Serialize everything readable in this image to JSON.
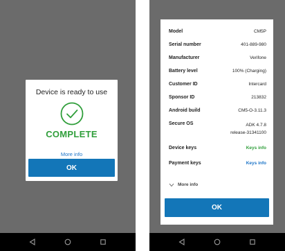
{
  "left_screen": {
    "dialog": {
      "title": "Device is ready to use",
      "status": "COMPLETE",
      "more_info": "More info",
      "ok": "OK",
      "check_icon": "check-circle-icon"
    }
  },
  "right_screen": {
    "rows": [
      {
        "label": "Model",
        "value": "CM5P"
      },
      {
        "label": "Serial number",
        "value": "401-889-980"
      },
      {
        "label": "Manufacturer",
        "value": "Verifone"
      },
      {
        "label": "Battery level",
        "value": "100% (Charging)"
      },
      {
        "label": "Customer ID",
        "value": "Intercard"
      },
      {
        "label": "Sponsor ID",
        "value": "213832"
      },
      {
        "label": "Android build",
        "value": "CM5-O-3.11.3"
      },
      {
        "label": "Secure OS",
        "value_line1": "ADK 4.7.8",
        "value_line2": "release-31341100"
      },
      {
        "label": "Device keys",
        "value": "Keys info"
      },
      {
        "label": "Payment keys",
        "value": "Keys info"
      }
    ],
    "more_info": "More info",
    "ok": "OK"
  },
  "navbar": {
    "back_icon": "back-icon",
    "home_icon": "home-icon",
    "recents_icon": "recents-icon"
  },
  "colors": {
    "accent": "#1376b8",
    "success": "#2f9e3a",
    "link": "#1a73c7",
    "backdrop": "#6b6b6b"
  }
}
